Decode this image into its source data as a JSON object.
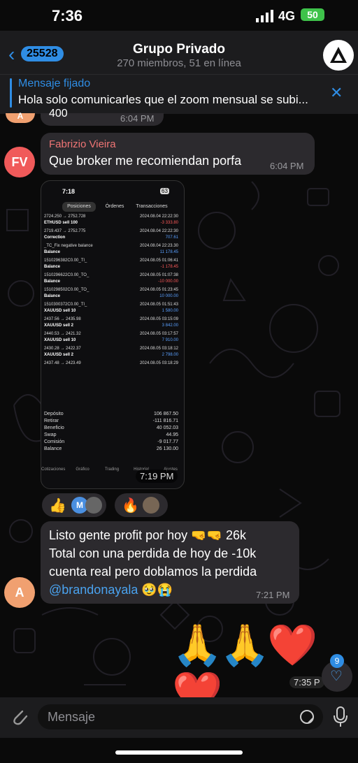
{
  "status": {
    "time": "7:36",
    "network": "4G",
    "battery": "50"
  },
  "header": {
    "back_count": "25528",
    "title": "Grupo Privado",
    "subtitle": "270 miembros, 51 en línea"
  },
  "pinned": {
    "title": "Mensaje fijado",
    "text": "Hola solo comunicarles que el zoom mensual se subi..."
  },
  "messages": {
    "partial": {
      "avatar": "A",
      "text": "400",
      "time": "6:04 PM"
    },
    "fabrizio": {
      "avatar": "FV",
      "name": "Fabrizio Vieira",
      "text": "Que broker me recomiendan porfa",
      "time": "6:04 PM"
    },
    "photo_time": "7:19 PM",
    "profit": {
      "avatar": "A",
      "line1": "Listo gente profit por hoy 🤜🤜 26k",
      "line2": "Total con una perdida de hoy de -10k",
      "line3": "cuenta real pero doblamos la perdida",
      "mention": "@brandonayala",
      "mention_emoji": "🥹😭",
      "time": "7:21 PM"
    },
    "emoji_msg": {
      "emojis": "🙏🙏❤️❤️",
      "time": "7:35 P",
      "likes": "9"
    }
  },
  "reactions": [
    {
      "emoji": "👍",
      "initial": "M"
    },
    {
      "emoji": "🔥"
    }
  ],
  "phone": {
    "time": "7:18",
    "battery": "63",
    "tabs": [
      "Posiciones",
      "Órdenes",
      "Transacciones"
    ],
    "rows": [
      {
        "l": "2724.250 → 2752.728",
        "r": "2024.08.04 22:22:30"
      },
      {
        "l": "ETHUSD sell 100",
        "r": "-3 333.80"
      },
      {
        "l": "2719.437 → 2752.775",
        "r": "2024.08.04 22:22:30"
      },
      {
        "l": "Correction",
        "r": "707.61"
      },
      {
        "l": "_TC_Fix negative balance",
        "r": "2024.08.04 22:23.30"
      },
      {
        "l": "Balance",
        "r": "11 178.45"
      },
      {
        "l": "1510296382C0.00_TI_",
        "r": "2024.08.05 01:06:41"
      },
      {
        "l": "Balance",
        "r": "-1 178.45"
      },
      {
        "l": "1510296622C0.00_TO_",
        "r": "2024.08.05 01:07:38"
      },
      {
        "l": "Balance",
        "r": "-10 000.00"
      },
      {
        "l": "1510298502C0.00_TO_",
        "r": "2024.08.05 01:23:45"
      },
      {
        "l": "Balance",
        "r": "10 000.00"
      },
      {
        "l": "1510300372C0.00_TI_",
        "r": "2024.08.05 01:51:43"
      },
      {
        "l": "XAUUSD sell 10",
        "r": "1 580.00"
      },
      {
        "l": "2437.56 → 2435.98",
        "r": "2024.08.05 03:15:09"
      },
      {
        "l": "XAUUSD sell 2",
        "r": "3 842.00"
      },
      {
        "l": "2440.53 → 2421.32",
        "r": "2024.08.05 03:17:57"
      },
      {
        "l": "XAUUSD sell 10",
        "r": "7 910.00"
      },
      {
        "l": "2430.28 → 2422.37",
        "r": "2024.08.05 03:18:12"
      },
      {
        "l": "XAUUSD sell 2",
        "r": "2 798.00"
      },
      {
        "l": "2437.48 → 2423.49",
        "r": "2024.08.05 03:18:29"
      }
    ],
    "summary": [
      {
        "l": "Depósito",
        "r": "106 867.50"
      },
      {
        "l": "Retirar",
        "r": "-111 816.71"
      },
      {
        "l": "Beneficio",
        "r": "40 052.03"
      },
      {
        "l": "Swap",
        "r": "44.95"
      },
      {
        "l": "Comisión",
        "r": "-9 017.77"
      },
      {
        "l": "Balance",
        "r": "26 130.00"
      }
    ],
    "nav": [
      "Cotizaciones",
      "Gráfico",
      "Trading",
      "Historial",
      "Ajustes"
    ]
  },
  "input": {
    "placeholder": "Mensaje"
  },
  "colors": {
    "accent": "#2f8de4",
    "bubble": "#2c2a2e",
    "positive": "#5aa0ff",
    "negative": "#ff5a5a"
  }
}
